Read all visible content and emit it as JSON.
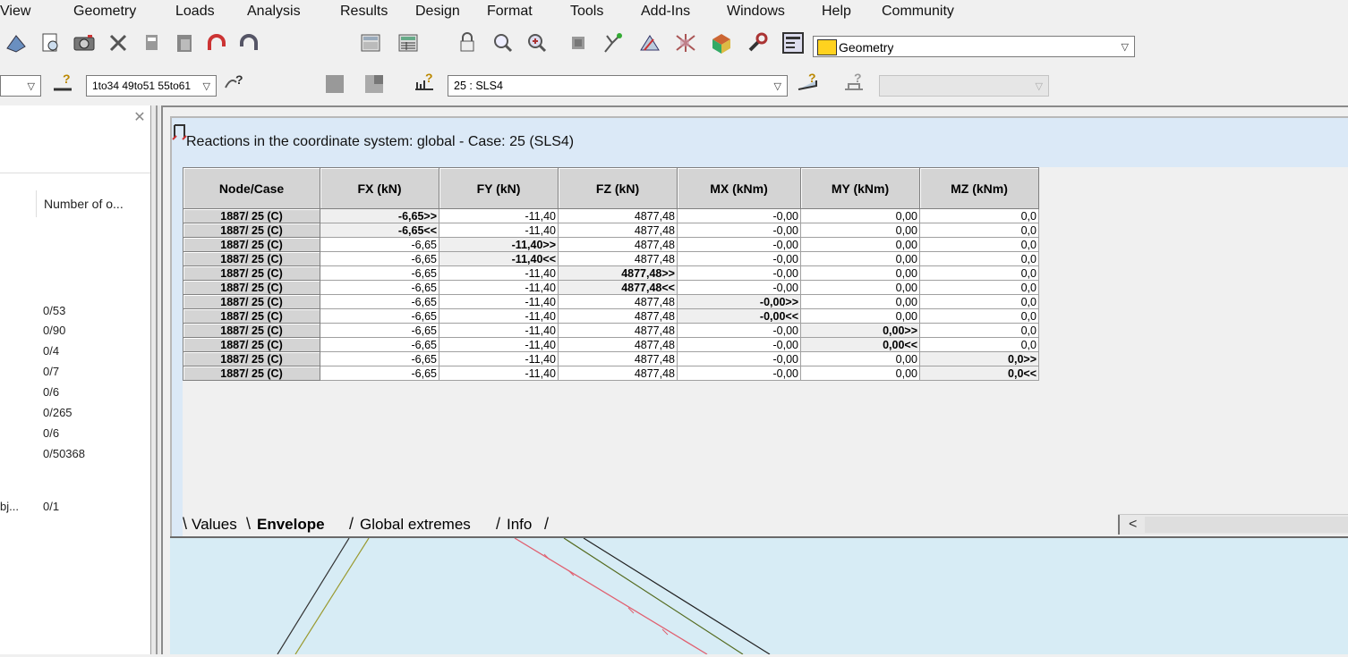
{
  "menu": [
    "View",
    "Geometry",
    "Loads",
    "Analysis",
    "Results",
    "Design",
    "Format",
    "Tools",
    "Add-Ins",
    "Windows",
    "Help",
    "Community"
  ],
  "toolbar1": {
    "layout_combo": "Geometry"
  },
  "toolbar2": {
    "selection_combo": "1to34 49to51 55to61",
    "case_combo": "25 : SLS4",
    "disabled_combo": ""
  },
  "left_panel": {
    "column_header": "Number of o...",
    "values": [
      "0/53",
      "0/90",
      "0/4",
      "0/7",
      "0/6",
      "0/265",
      "0/6",
      "0/50368"
    ],
    "last_label": "bj...",
    "last_value": "0/1"
  },
  "results": {
    "title": "Reactions in the coordinate system: global - Case: 25 (SLS4)",
    "columns": [
      "Node/Case",
      "FX (kN)",
      "FY (kN)",
      "FZ (kN)",
      "MX (kNm)",
      "MY (kNm)",
      "MZ (kNm)"
    ],
    "rows": [
      [
        "1887/ 25 (C)",
        "-6,65>>",
        "-11,40",
        "4877,48",
        "-0,00",
        "0,00",
        "0,0"
      ],
      [
        "1887/ 25 (C)",
        "-6,65<<",
        "-11,40",
        "4877,48",
        "-0,00",
        "0,00",
        "0,0"
      ],
      [
        "1887/ 25 (C)",
        "-6,65",
        "-11,40>>",
        "4877,48",
        "-0,00",
        "0,00",
        "0,0"
      ],
      [
        "1887/ 25 (C)",
        "-6,65",
        "-11,40<<",
        "4877,48",
        "-0,00",
        "0,00",
        "0,0"
      ],
      [
        "1887/ 25 (C)",
        "-6,65",
        "-11,40",
        "4877,48>>",
        "-0,00",
        "0,00",
        "0,0"
      ],
      [
        "1887/ 25 (C)",
        "-6,65",
        "-11,40",
        "4877,48<<",
        "-0,00",
        "0,00",
        "0,0"
      ],
      [
        "1887/ 25 (C)",
        "-6,65",
        "-11,40",
        "4877,48",
        "-0,00>>",
        "0,00",
        "0,0"
      ],
      [
        "1887/ 25 (C)",
        "-6,65",
        "-11,40",
        "4877,48",
        "-0,00<<",
        "0,00",
        "0,0"
      ],
      [
        "1887/ 25 (C)",
        "-6,65",
        "-11,40",
        "4877,48",
        "-0,00",
        "0,00>>",
        "0,0"
      ],
      [
        "1887/ 25 (C)",
        "-6,65",
        "-11,40",
        "4877,48",
        "-0,00",
        "0,00<<",
        "0,0"
      ],
      [
        "1887/ 25 (C)",
        "-6,65",
        "-11,40",
        "4877,48",
        "-0,00",
        "0,00",
        "0,0>>"
      ],
      [
        "1887/ 25 (C)",
        "-6,65",
        "-11,40",
        "4877,48",
        "-0,00",
        "0,00",
        "0,0<<"
      ]
    ],
    "tabs": [
      "Values",
      "Envelope",
      "Global extremes",
      "Info"
    ],
    "active_tab": "Envelope"
  }
}
